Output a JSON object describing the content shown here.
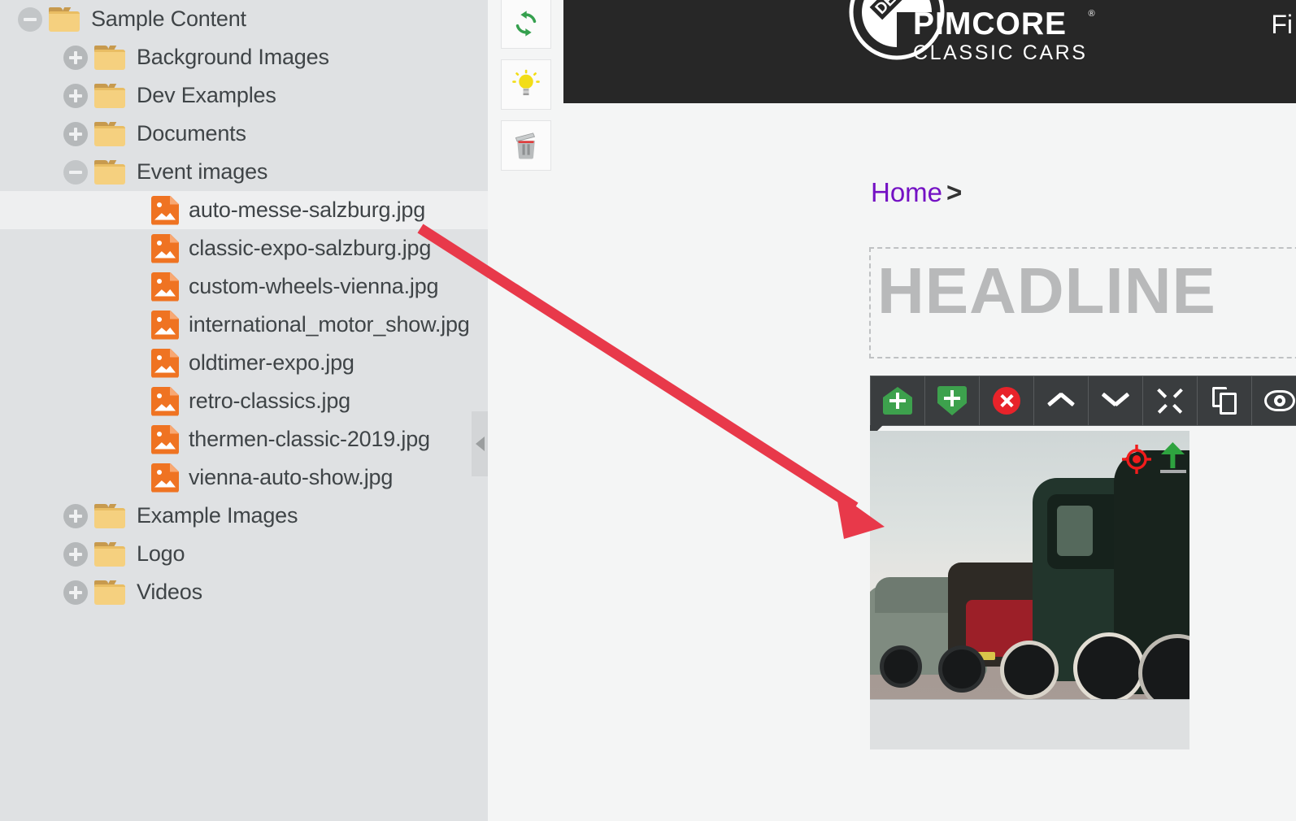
{
  "tree": {
    "name": "asset-tree",
    "items": [
      {
        "label": "Sample Content",
        "type": "folder",
        "state": "expanded",
        "depth": 0,
        "selected": false
      },
      {
        "label": "Background Images",
        "type": "folder",
        "state": "collapsed",
        "depth": 1,
        "selected": false
      },
      {
        "label": "Dev Examples",
        "type": "folder",
        "state": "collapsed",
        "depth": 1,
        "selected": false
      },
      {
        "label": "Documents",
        "type": "folder",
        "state": "collapsed",
        "depth": 1,
        "selected": false
      },
      {
        "label": "Event images",
        "type": "folder",
        "state": "expanded",
        "depth": 1,
        "selected": false
      },
      {
        "label": "auto-messe-salzburg.jpg",
        "type": "image",
        "state": "leaf",
        "depth": 2,
        "selected": true
      },
      {
        "label": "classic-expo-salzburg.jpg",
        "type": "image",
        "state": "leaf",
        "depth": 2,
        "selected": false
      },
      {
        "label": "custom-wheels-vienna.jpg",
        "type": "image",
        "state": "leaf",
        "depth": 2,
        "selected": false
      },
      {
        "label": "international_motor_show.jpg",
        "type": "image",
        "state": "leaf",
        "depth": 2,
        "selected": false
      },
      {
        "label": "oldtimer-expo.jpg",
        "type": "image",
        "state": "leaf",
        "depth": 2,
        "selected": false
      },
      {
        "label": "retro-classics.jpg",
        "type": "image",
        "state": "leaf",
        "depth": 2,
        "selected": false
      },
      {
        "label": "thermen-classic-2019.jpg",
        "type": "image",
        "state": "leaf",
        "depth": 2,
        "selected": false
      },
      {
        "label": "vienna-auto-show.jpg",
        "type": "image",
        "state": "leaf",
        "depth": 2,
        "selected": false
      },
      {
        "label": "Example Images",
        "type": "folder",
        "state": "collapsed",
        "depth": 1,
        "selected": false
      },
      {
        "label": "Logo",
        "type": "folder",
        "state": "collapsed",
        "depth": 1,
        "selected": false
      },
      {
        "label": "Videos",
        "type": "folder",
        "state": "collapsed",
        "depth": 1,
        "selected": false
      }
    ]
  },
  "toolbar": {
    "buttons": [
      {
        "icon": "refresh-icon",
        "label": "Reload"
      },
      {
        "icon": "lightbulb-icon",
        "label": "Hints"
      },
      {
        "icon": "trash-icon",
        "label": "Delete"
      }
    ]
  },
  "collapse_handle": {
    "icon": "chevron-left-icon"
  },
  "preview": {
    "header": {
      "logo_main": "PIMCORE",
      "logo_registered": "®",
      "logo_sub": "CLASSIC CARS",
      "badge_text": "DEMO",
      "nav_item": "Fi"
    },
    "breadcrumb": {
      "home": "Home",
      "separator": ">"
    },
    "headline": {
      "placeholder": "HEADLINE"
    },
    "edit_toolbar": {
      "buttons": [
        {
          "icon": "add-above-icon",
          "label": "Add block above"
        },
        {
          "icon": "add-below-icon",
          "label": "Add block below"
        },
        {
          "icon": "delete-icon",
          "label": "Remove block"
        },
        {
          "icon": "chevron-up-icon",
          "label": "Move up"
        },
        {
          "icon": "chevron-down-icon",
          "label": "Move down"
        },
        {
          "icon": "expand-icon",
          "label": "Fullscreen"
        },
        {
          "icon": "copy-icon",
          "label": "Copy block"
        },
        {
          "icon": "eye-icon",
          "label": "Preview"
        }
      ]
    },
    "image_block": {
      "name": "classic-cars-photo",
      "focal_point_icon": "focal-point-icon",
      "upload_icon": "upload-arrow-icon"
    }
  },
  "annotation": {
    "type": "arrow",
    "color": "#e8394a",
    "from": "auto-messe-salzburg.jpg",
    "to": "image-drop-target"
  },
  "colors": {
    "sidebar_bg": "#dfe1e3",
    "selected_row": "#eeeff0",
    "preview_bg": "#f4f5f5",
    "header_dark": "#272727",
    "accent_purple": "#7411c4",
    "annotation_red": "#e8394a",
    "icon_orange": "#ef7322",
    "folder_yellow": "#f5d07f",
    "green": "#3da14d",
    "red": "#e8232a"
  }
}
